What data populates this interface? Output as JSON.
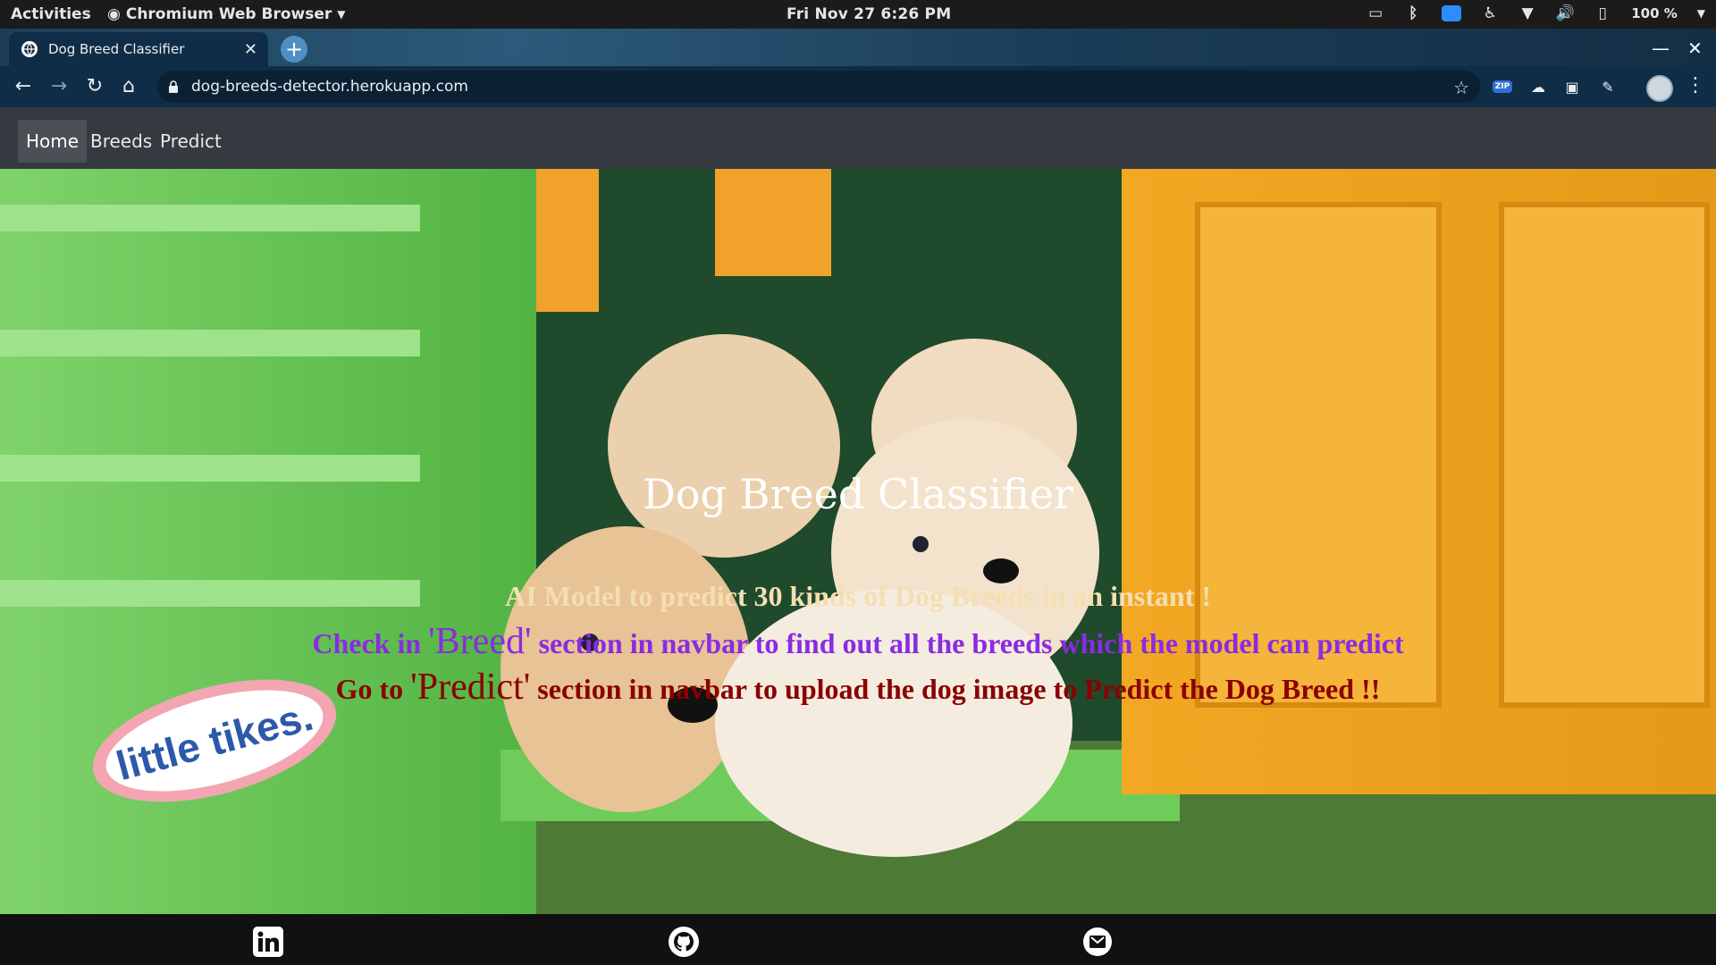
{
  "topbar": {
    "activities": "Activities",
    "app_name": "Chromium Web Browser",
    "clock": "Fri Nov 27   6:26 PM",
    "battery": "100 %"
  },
  "browser": {
    "tab_title": "Dog Breed Classifier",
    "url": "dog-breeds-detector.herokuapp.com",
    "ext_zip_label": "ZIP"
  },
  "site": {
    "nav": {
      "home": "Home",
      "breeds": "Breeds",
      "predict": "Predict"
    },
    "hero": {
      "title": "Dog Breed Classifier",
      "line1": "AI Model to predict 30 kinds of Dog Breeds in an instant !",
      "line2_pre": "Check in ",
      "line2_hl": "'Breed'",
      "line2_post": " section in navbar to find out all the breeds which the model can predict",
      "line3_pre": "Go to ",
      "line3_hl": "'Predict'",
      "line3_post": " section in navbar to upload the dog image to Predict the Dog Breed !!",
      "sticker_text": "little tikes."
    },
    "footer_icons": [
      "linkedin-icon",
      "github-icon",
      "gmail-icon"
    ]
  }
}
